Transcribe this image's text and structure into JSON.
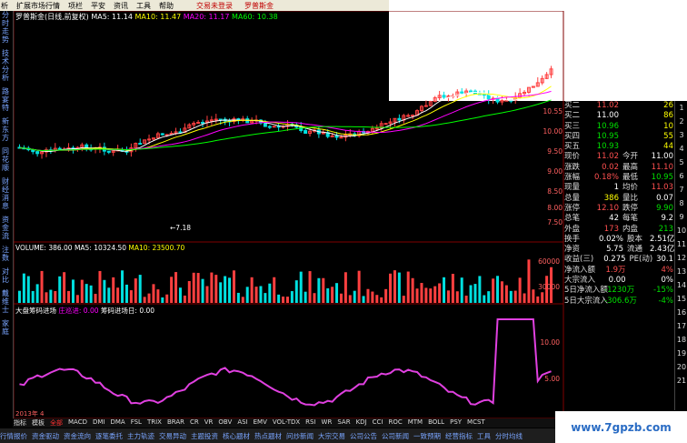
{
  "menu": {
    "items": [
      "析",
      "扩展市场行情",
      "资讯",
      "工具",
      "帮助"
    ],
    "items_mid": [
      "资讯",
      "平安"
    ],
    "login": "交易未登录",
    "stock": "罗普斯金",
    "raw": [
      "析",
      "扩展市场行情",
      "项栏",
      "平安",
      "资讯",
      "工具",
      "帮助"
    ]
  },
  "left_tabs": [
    "分时走势",
    "技术分析",
    "路宴特",
    "新东方",
    "同花顺",
    "财经消息",
    "资金流",
    "注数",
    "对比",
    "戴维士",
    "家庭"
  ],
  "chart_title": {
    "name": "罗普斯金(日线,前复权)",
    "ma5": "MA5: 11.14",
    "ma10": "MA10: 11.47",
    "ma20": "MA20: 11.17",
    "ma60": "MA60: 10.38"
  },
  "price_axis": [
    "10.55",
    "10.00",
    "9.50",
    "9.00",
    "8.50",
    "8.00",
    "7.50"
  ],
  "low_label": "7.18",
  "volume_title": {
    "label": "VOLUME: 386.00",
    "ma5": "MA5: 10324.50",
    "ma10": "MA10: 23500.70"
  },
  "volume_axis": [
    "60000",
    "30000"
  ],
  "indicator_title": {
    "name": "大盘筹码进场",
    "s1": "庄巡进: 0.00",
    "s2": "筹码进场日: 0.00"
  },
  "indicator_axis": [
    "10.00",
    "5.00"
  ],
  "indicator_date": "2013年 4",
  "quote": {
    "rows": [
      {
        "l": "买二",
        "v": "11.02",
        "vc": "red",
        "l2": "",
        "v2": "26",
        "v2c": "yellow"
      },
      {
        "l": "买二",
        "v": "11.00",
        "vc": "white",
        "l2": "",
        "v2": "86",
        "v2c": "yellow"
      },
      {
        "l": "买三",
        "v": "10.96",
        "vc": "green",
        "l2": "",
        "v2": "10",
        "v2c": "yellow"
      },
      {
        "l": "买四",
        "v": "10.95",
        "vc": "green",
        "l2": "",
        "v2": "55",
        "v2c": "yellow"
      },
      {
        "l": "买五",
        "v": "10.93",
        "vc": "green",
        "l2": "",
        "v2": "44",
        "v2c": "yellow"
      },
      {
        "l": "现价",
        "v": "11.02",
        "vc": "red",
        "l2": "今开",
        "v2": "11.00",
        "v2c": "white"
      },
      {
        "l": "涨跌",
        "v": "0.02",
        "vc": "red",
        "l2": "最高",
        "v2": "11.10",
        "v2c": "red"
      },
      {
        "l": "涨幅",
        "v": "0.18%",
        "vc": "red",
        "l2": "最低",
        "v2": "10.95",
        "v2c": "green"
      },
      {
        "l": "现量",
        "v": "1",
        "vc": "white",
        "l2": "均价",
        "v2": "11.03",
        "v2c": "red"
      },
      {
        "l": "总量",
        "v": "386",
        "vc": "yellow",
        "l2": "量比",
        "v2": "0.07",
        "v2c": "white"
      },
      {
        "l": "涨停",
        "v": "12.10",
        "vc": "red",
        "l2": "跌停",
        "v2": "9.90",
        "v2c": "green"
      },
      {
        "l": "总笔",
        "v": "42",
        "vc": "white",
        "l2": "每笔",
        "v2": "9.2",
        "v2c": "white"
      },
      {
        "l": "外盘",
        "v": "173",
        "vc": "red",
        "l2": "内盘",
        "v2": "213",
        "v2c": "green"
      },
      {
        "l": "换手",
        "v": "0.02%",
        "vc": "white",
        "l2": "股本",
        "v2": "2.51亿",
        "v2c": "white"
      },
      {
        "l": "净资",
        "v": "5.75",
        "vc": "white",
        "l2": "流通",
        "v2": "2.43亿",
        "v2c": "white"
      },
      {
        "l": "收益(三)",
        "v": "0.275",
        "vc": "white",
        "l2": "PE(动)",
        "v2": "30.1",
        "v2c": "white"
      },
      {
        "l": "净流入额",
        "v": "1.9万",
        "vc": "red",
        "l2": "",
        "v2": "4%",
        "v2c": "red"
      },
      {
        "l": "大宗流入",
        "v": "0.00",
        "vc": "white",
        "l2": "",
        "v2": "0%",
        "v2c": "white"
      },
      {
        "l": "5日净流入额",
        "v": "-1230万",
        "vc": "green",
        "l2": "",
        "v2": "-15%",
        "v2c": "green"
      },
      {
        "l": "5日大宗流入",
        "v": "-306.6万",
        "vc": "green",
        "l2": "",
        "v2": "-4%",
        "v2c": "green"
      }
    ]
  },
  "right_strip": [
    "1",
    "2",
    "3",
    "4",
    "5",
    "6",
    "7",
    "8",
    "9",
    "10",
    "11",
    "12",
    "13",
    "14",
    "15",
    "16",
    "17",
    "18",
    "19",
    "20",
    "21"
  ],
  "bottom_tabs": [
    "指标",
    "模板",
    "全部",
    "MACD",
    "DMI",
    "DMA",
    "FSL",
    "TRIX",
    "BRAR",
    "CR",
    "VR",
    "OBV",
    "ASI",
    "EMV",
    "VOL-TDX",
    "RSI",
    "WR",
    "SAR",
    "KDJ",
    "CCI",
    "ROC",
    "MTM",
    "BOLL",
    "PSY",
    "MCST"
  ],
  "status_items": [
    "行情报价",
    "资金驱动",
    "资金流向",
    "逐笔委托",
    "主力轨迹",
    "交易异动",
    "主题投资",
    "核心题材",
    "热点题材",
    "问炒新闻",
    "大宗交易",
    "公司公告",
    "公司新闻",
    "一致预期",
    "经营指标",
    "工具",
    "分时均线"
  ],
  "watermark": "www.7gpzb.com",
  "right_date": "日线"
}
